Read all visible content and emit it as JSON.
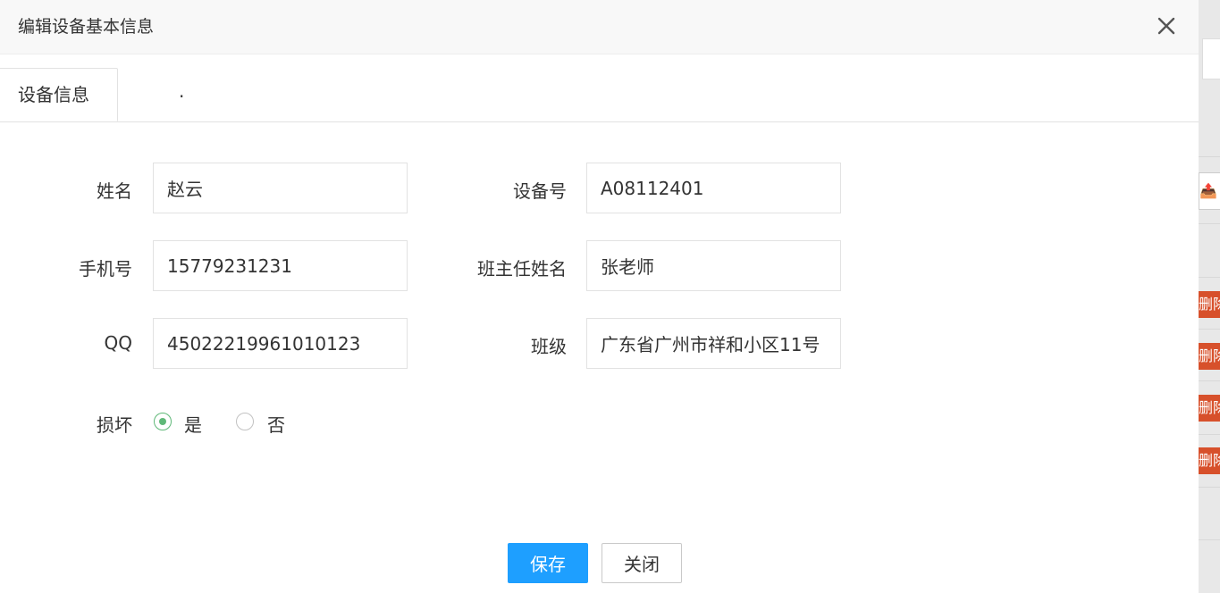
{
  "dialog": {
    "title": "编辑设备基本信息",
    "close_icon": "close-icon"
  },
  "tabs": [
    {
      "label": "设备信息",
      "active": true
    },
    {
      "label": ".",
      "active": false
    }
  ],
  "form": {
    "name": {
      "label": "姓名",
      "value": "赵云"
    },
    "device_no": {
      "label": "设备号",
      "value": "A08112401"
    },
    "phone": {
      "label": "手机号",
      "value": "15779231231"
    },
    "teacher": {
      "label": "班主任姓名",
      "value": "张老师"
    },
    "qq": {
      "label": "QQ",
      "value": "45022219961010123"
    },
    "class": {
      "label": "班级",
      "value": "广东省广州市祥和小区11号"
    },
    "damaged": {
      "label": "损坏",
      "options": [
        {
          "label": "是",
          "checked": true
        },
        {
          "label": "否",
          "checked": false
        }
      ]
    }
  },
  "buttons": {
    "save": "保存",
    "close": "关闭"
  },
  "background": {
    "delete_labels": [
      "删除",
      "删除",
      "删除",
      "删除"
    ],
    "export_icon": "export-icon"
  },
  "colors": {
    "primary": "#1e9fff",
    "radio_checked": "#5fb878",
    "delete_button": "#d7502b"
  }
}
